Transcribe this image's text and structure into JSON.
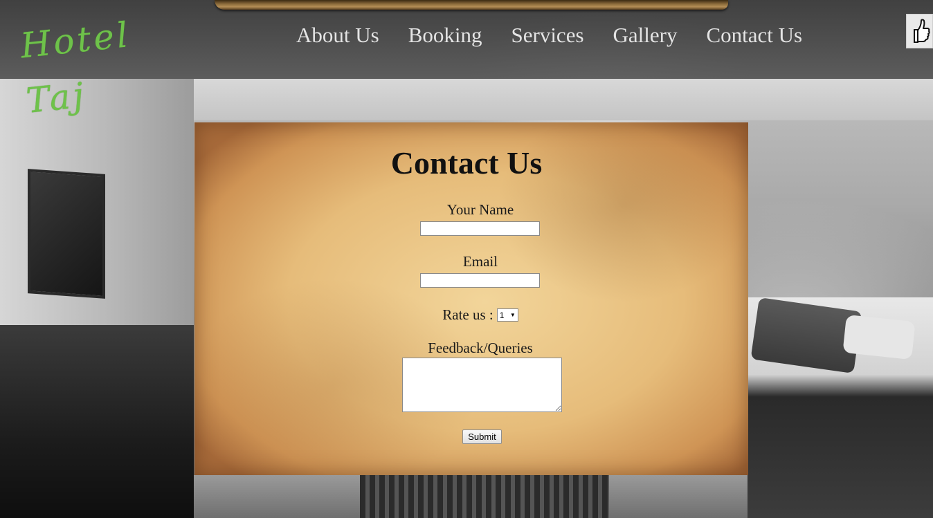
{
  "brand": {
    "logo_text": "Hotel Taj",
    "logo_color": "#6ec24a"
  },
  "nav": {
    "items": [
      {
        "label": "About Us"
      },
      {
        "label": "Booking"
      },
      {
        "label": "Services"
      },
      {
        "label": "Gallery"
      },
      {
        "label": "Contact Us"
      }
    ],
    "like_icon": "thumbs-up-icon"
  },
  "contact": {
    "title": "Contact Us",
    "name_label": "Your Name",
    "name_value": "",
    "email_label": "Email",
    "email_value": "",
    "rate_label": "Rate us :",
    "rate_selected": "1",
    "feedback_label": "Feedback/Queries",
    "feedback_value": "",
    "submit_label": "Submit"
  }
}
